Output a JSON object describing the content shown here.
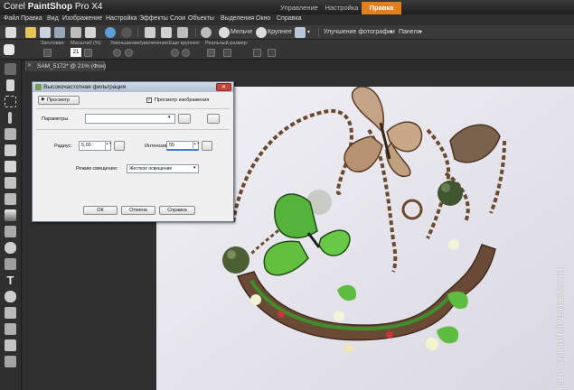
{
  "app": {
    "logo_prefix": "Corel",
    "logo_name": "PaintShop",
    "logo_suffix": "Pro X4",
    "tabs": [
      "Управление",
      "Настройка",
      "Правка"
    ],
    "active_tab": "Правка",
    "accent_color": "#e2801e"
  },
  "menu": [
    "Файл",
    "Правка",
    "Вид",
    "Изображение",
    "Настройка",
    "Эффекты",
    "Слои",
    "Объекты",
    "Выделения",
    "Окно",
    "Справка"
  ],
  "toolbar": {
    "zoom_out_label": "Мельче",
    "zoom_in_label": "Крупнее",
    "enhance_label": "Улучшение фотографии",
    "panels_label": "Панели"
  },
  "options": {
    "presets_label": "Заготовки:",
    "scale_label": "Масштаб (%)",
    "scale_value": "21",
    "zoom_inout_label": "Уменьшение/увеличение:",
    "larger_label": "Еще крупнее:",
    "actual_size_label": "Реальный размер:"
  },
  "document": {
    "tab_label": "SAM_5172* @ 21% (Фон)"
  },
  "dialog": {
    "title": "Высокочастотная фильтрация",
    "preview_button": "Просмотр",
    "preview_image_label": "Просмотр изображения",
    "preview_checked": true,
    "params_label": "Параметры",
    "params_value": "",
    "radius_label": "Радиус:",
    "radius_value": "5,00",
    "intensity_label": "Интенсивность:",
    "intensity_value": "55",
    "blend_label": "Режим смещения:",
    "blend_value": "Жесткое освещение",
    "ok_label": "ОК",
    "cancel_label": "Отмена",
    "help_label": "Справка",
    "close_symbol": "✕"
  },
  "watermark": "ksu-handart.livemaster.ru"
}
